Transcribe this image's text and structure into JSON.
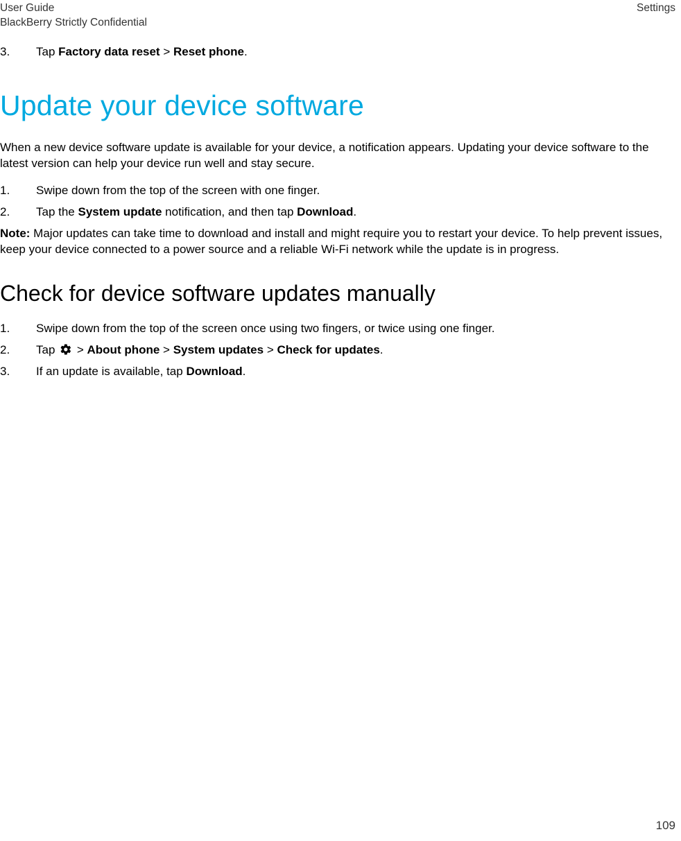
{
  "header": {
    "left_line1": "User Guide",
    "left_line2": "BlackBerry Strictly Confidential",
    "right": "Settings"
  },
  "top_step": {
    "num": "3.",
    "pre": "Tap ",
    "b1": "Factory data reset",
    "mid": " > ",
    "b2": "Reset phone",
    "post": "."
  },
  "h1": "Update your device software",
  "intro": "When a new device software update is available for your device, a notification appears. Updating your device software to the latest version can help your device run well and stay secure.",
  "steps_a": [
    {
      "num": "1.",
      "plain": "Swipe down from the top of the screen with one finger."
    },
    {
      "num": "2.",
      "pre": "Tap the ",
      "b1": "System update",
      "mid1": " notification, and then tap ",
      "b2": "Download",
      "post": "."
    }
  ],
  "note": {
    "label": "Note:",
    "text": " Major updates can take time to download and install and might require you to restart your device. To help prevent issues, keep your device connected to a power source and a reliable Wi-Fi network while the update is in progress."
  },
  "h2": "Check for device software updates manually",
  "steps_b": [
    {
      "num": "1.",
      "plain": "Swipe down from the top of the screen once using two fingers, or twice using one finger."
    },
    {
      "num": "2.",
      "pre": "Tap ",
      "icon": true,
      "mid0": " > ",
      "b1": "About phone",
      "mid1": " > ",
      "b2": "System updates",
      "mid2": " > ",
      "b3": "Check for updates",
      "post": "."
    },
    {
      "num": "3.",
      "pre": "If an update is available, tap ",
      "b1": "Download",
      "post": "."
    }
  ],
  "page_number": "109"
}
